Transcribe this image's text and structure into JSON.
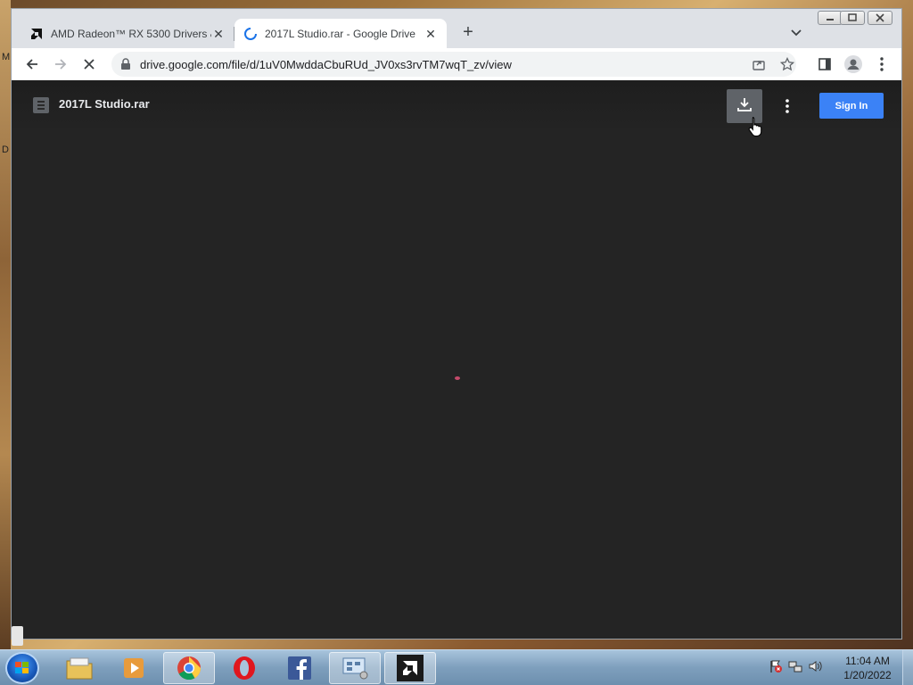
{
  "desktop": {
    "left_label_1": "M",
    "left_label_2": "D"
  },
  "browser": {
    "tabs": [
      {
        "title": "AMD Radeon™ RX 5300 Drivers & ",
        "close": "✕",
        "favicon": "amd-logo-icon"
      },
      {
        "title": "2017L Studio.rar - Google Drive",
        "close": "✕",
        "favicon": "loading-spinner-icon"
      }
    ],
    "new_tab": "+",
    "address_bar": {
      "url": "drive.google.com/file/d/1uV0MwddaCbuRUd_JV0xs3rvTM7wqT_zv/view"
    }
  },
  "drive_viewer": {
    "file_name": "2017L Studio.rar",
    "sign_in_label": "Sign In",
    "accent_color": "#3b82f6"
  },
  "taskbar": {
    "apps": [
      "windows-explorer",
      "media-player",
      "google-chrome",
      "opera",
      "facebook",
      "control-panel",
      "amd-software"
    ],
    "clock": {
      "time": "11:04 AM",
      "date": "1/20/2022"
    }
  }
}
